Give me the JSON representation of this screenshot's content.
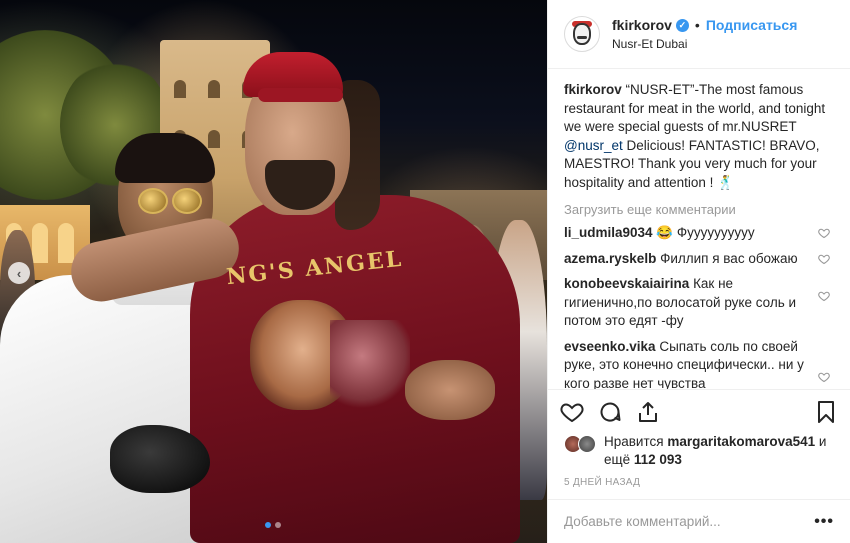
{
  "header": {
    "username": "fkirkorov",
    "separator": "•",
    "follow_label": "Подписаться",
    "location": "Nusr-Et Dubai",
    "verified_mark": "✓"
  },
  "caption": {
    "username": "fkirkorov",
    "text_1": " “NUSR-ET”-The most famous restaurant for meat in the world, and tonight we were special guests of mr.NUSRET ",
    "mention": "@nusr_et",
    "text_2": " Delicious! FANTASTIC! BRAVO, MAESTRO! Thank you very much for your hospitality and attention ! 🕺"
  },
  "load_more_label": "Загрузить еще комментарии",
  "comments": [
    {
      "username": "li_udmila9034",
      "text": " 😂 Фуууууууууу"
    },
    {
      "username": "azema.ryskelb",
      "text": " Филлип я вас обожаю"
    },
    {
      "username": "konobeevskaiairina",
      "text": " Как не гигиенично,по волосатой руке соль и потом это едят -фу"
    },
    {
      "username": "evseenko.vika",
      "text": " Сыпать соль по своей руке, это конечно специфически.. ни у кого разве нет чувства брезгливости??? 😩 Может это и круто, но.... 😱"
    }
  ],
  "likes": {
    "prefix": "Нравится ",
    "user": "margaritakomarova541",
    "middle": " и ещё ",
    "count": "112 093"
  },
  "timestamp": "5 ДНЕЙ НАЗАД",
  "add_comment": {
    "placeholder": "Добавьте комментарий...",
    "more_label": "•••"
  },
  "photo": {
    "shirt_text": "NG'S ANGEL",
    "carousel_prev": "‹",
    "slides_total": 2,
    "slide_active": 1
  },
  "icons": {
    "heart": "heart-icon",
    "comment": "comment-icon",
    "share": "share-icon",
    "bookmark": "bookmark-icon"
  },
  "colors": {
    "accent": "#3897f0",
    "text": "#262626",
    "muted": "#999999",
    "border": "#efefef"
  }
}
